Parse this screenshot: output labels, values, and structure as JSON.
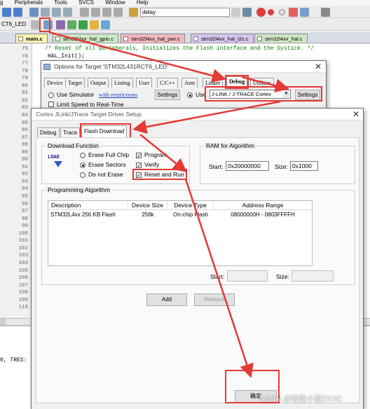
{
  "menubar": [
    "g",
    "Peripherals",
    "Tools",
    "SVCS",
    "Window",
    "Help"
  ],
  "toolbar": {
    "find_value": "delay"
  },
  "target_combo": "CT6_LED",
  "file_tabs": [
    {
      "label": "main.c",
      "color": "#fdf6b0"
    },
    {
      "label": "stm32l4xx_hal_gpio.c",
      "color": "#cfe8c6"
    },
    {
      "label": "stm32l4xx_hal_pwr.c",
      "color": "#f4b8c2"
    },
    {
      "label": "stm32l4xx_hal_i2c.c",
      "color": "#d8c6ef"
    },
    {
      "label": "stm32l4xx_hal.c",
      "color": "#cfe8c6"
    }
  ],
  "editor": {
    "line_numbers": [
      "75",
      "76",
      "77",
      "78",
      "79",
      "80",
      "81",
      "82",
      "83",
      "84",
      "85",
      "86",
      "87",
      "88",
      "89",
      "90",
      "91",
      "92",
      "93",
      "94",
      "95",
      "96",
      "97",
      "98",
      "99",
      "100",
      "101",
      "102",
      "103",
      "104",
      "105",
      "106",
      "107",
      "108",
      "109",
      "110"
    ],
    "line_75": "/* Reset of all peripherals, Initializes the Flash interface and the Systick. */",
    "line_76": "HAL_Init();"
  },
  "output": {
    "text": "0, TRES:"
  },
  "options_dialog": {
    "title": "Options for Target 'STM32L431RCT6_LED'",
    "tabs": [
      "Device",
      "Target",
      "Output",
      "Listing",
      "User",
      "C/C++",
      "Asm",
      "Linker",
      "Debug",
      "Utilities"
    ],
    "use_simulator": "Use Simulator",
    "with_restrictions": "with restrictions",
    "settings": "Settings",
    "use_partial": "Use",
    "debugger": "J-LINK / J-TRACE Cortex",
    "limit_speed": "Limit Speed to Real-Time"
  },
  "driver_dialog": {
    "title": "Cortex JLink/JTrace Target Driver Setup",
    "tabs": [
      "Debug",
      "Trace",
      "Flash Download"
    ],
    "download_function": {
      "group": "Download Function",
      "load_icon_text": "LOAD",
      "erase_full_chip": "Erase Full Chip",
      "erase_sectors": "Erase Sectors",
      "do_not_erase": "Do not Erase",
      "program": "Program",
      "verify": "Verify",
      "reset_and_run": "Reset and Run"
    },
    "ram": {
      "group": "RAM for Algorithm",
      "start_label": "Start:",
      "start_value": "0x20000000",
      "size_label": "Size:",
      "size_value": "0x1000"
    },
    "algorithm": {
      "group": "Programming Algorithm",
      "columns": [
        "Description",
        "Device Size",
        "Device Type",
        "Address Range"
      ],
      "rows": [
        {
          "description": "STM32L4xx 256 KB Flash",
          "size": "256k",
          "type": "On-chip Flash",
          "range": "08000000H - 0803FFFFH"
        }
      ],
      "start_label": "Start:",
      "size_label": "Size:"
    },
    "add_button": "Add",
    "remove_button": "Remove",
    "ok_button": "确定"
  },
  "watermark": "CSDN @智能小屋ZYXC",
  "annotation_color": "#e53935"
}
